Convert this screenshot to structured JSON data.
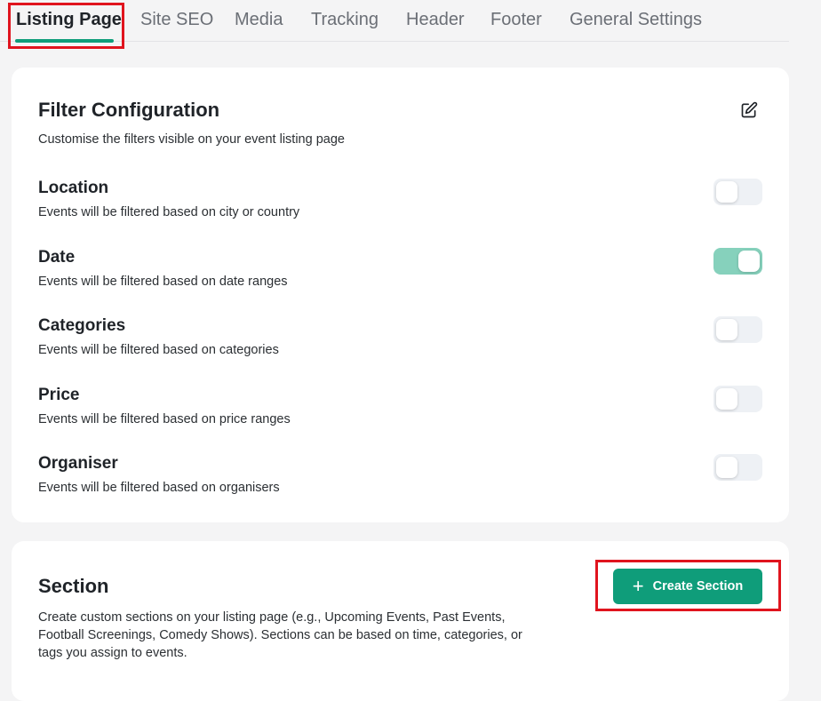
{
  "tabs": [
    {
      "label": "Listing Page",
      "active": true
    },
    {
      "label": "Site SEO"
    },
    {
      "label": "Media"
    },
    {
      "label": "Tracking"
    },
    {
      "label": "Header"
    },
    {
      "label": "Footer"
    },
    {
      "label": "General Settings"
    }
  ],
  "filter_config": {
    "title": "Filter Configuration",
    "subtitle": "Customise the filters visible on your event listing page",
    "edit_icon": "edit-icon",
    "filters": [
      {
        "label": "Location",
        "description": "Events will be filtered based on city or country",
        "enabled": false
      },
      {
        "label": "Date",
        "description": "Events will be filtered based on date ranges",
        "enabled": true
      },
      {
        "label": "Categories",
        "description": "Events will be filtered based on categories",
        "enabled": false
      },
      {
        "label": "Price",
        "description": "Events will be filtered based on price ranges",
        "enabled": false
      },
      {
        "label": "Organiser",
        "description": "Events will be filtered based on organisers",
        "enabled": false
      }
    ]
  },
  "section": {
    "title": "Section",
    "description": "Create custom sections on your listing page (e.g., Upcoming Events, Past Events, Football Screenings, Comedy Shows). Sections can be based on time, categories, or tags you assign to events.",
    "create_button_label": "Create Section",
    "create_button_icon": "plus-icon"
  },
  "colors": {
    "accent": "#0f9d7a",
    "toggle_on": "#86d1bc",
    "toggle_off": "#eef1f5",
    "highlight": "#e0141e"
  }
}
